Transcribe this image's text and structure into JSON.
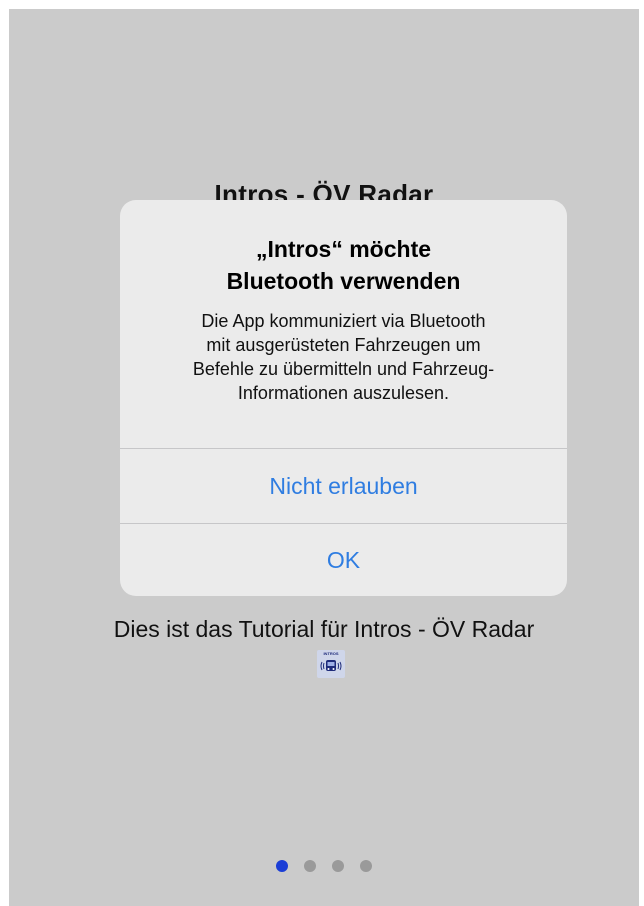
{
  "background": {
    "title": "Intros - ÖV Radar",
    "subtitle": "Dies ist das Tutorial für Intros - ÖV Radar",
    "app_icon": {
      "name": "bus-radar-icon",
      "label": "INTROS"
    }
  },
  "alert": {
    "title_lines": [
      "„Intros“ möchte",
      "Bluetooth verwenden"
    ],
    "message_lines": [
      "Die App kommuniziert via Bluetooth",
      "mit ausgerüsteten Fahrzeugen um",
      "Befehle zu übermitteln und Fahrzeug-",
      "Informationen auszulesen."
    ],
    "buttons": {
      "deny_label": "Nicht erlauben",
      "ok_label": "OK"
    }
  },
  "pager": {
    "count": 4,
    "active_index": 0
  },
  "colors": {
    "screen_background": "#cbcbcb",
    "alert_background": "#ebebeb",
    "button_text": "#2f7de1",
    "active_dot": "#1b3ed6",
    "inactive_dot": "#9a9a9a"
  }
}
